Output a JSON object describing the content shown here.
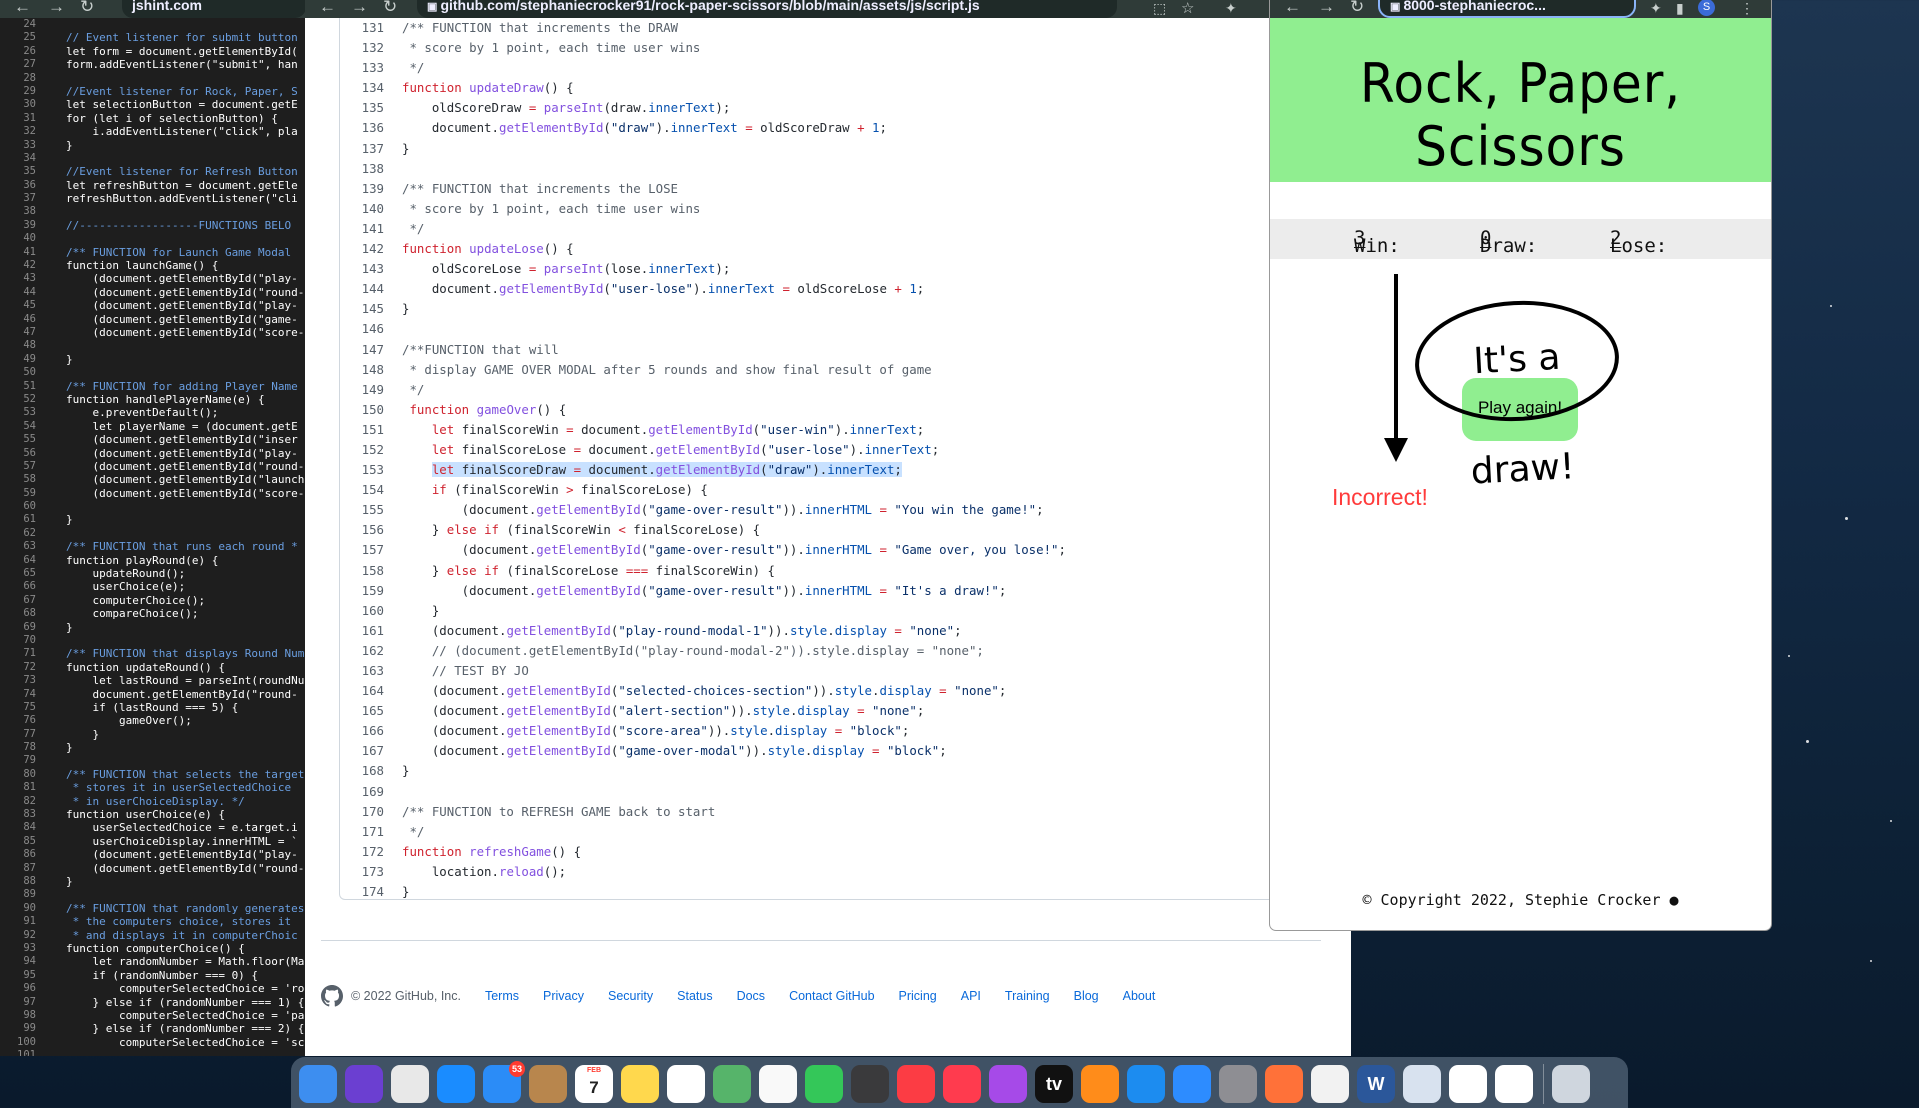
{
  "windows": {
    "jshint": {
      "tab_title": "jshint.com",
      "code_lines": [
        {
          "n": "24",
          "t": ""
        },
        {
          "n": "25",
          "t": "// Event listener for submit button",
          "c": "cm"
        },
        {
          "n": "26",
          "t": "let form = document.getElementById("
        },
        {
          "n": "27",
          "t": "form.addEventListener(\"submit\", han"
        },
        {
          "n": "28",
          "t": ""
        },
        {
          "n": "29",
          "t": "//Event listener for Rock, Paper, S",
          "c": "cm"
        },
        {
          "n": "30",
          "t": "let selectionButton = document.getE"
        },
        {
          "n": "31",
          "t": "for (let i of selectionButton) {"
        },
        {
          "n": "32",
          "t": "    i.addEventListener(\"click\", pla"
        },
        {
          "n": "33",
          "t": "}"
        },
        {
          "n": "34",
          "t": ""
        },
        {
          "n": "35",
          "t": "//Event listener for Refresh Button",
          "c": "cm"
        },
        {
          "n": "36",
          "t": "let refreshButton = document.getEle"
        },
        {
          "n": "37",
          "t": "refreshButton.addEventListener(\"cli"
        },
        {
          "n": "38",
          "t": ""
        },
        {
          "n": "39",
          "t": "//------------------FUNCTIONS BELO",
          "c": "cm"
        },
        {
          "n": "40",
          "t": ""
        },
        {
          "n": "41",
          "t": "/** FUNCTION for Launch Game Modal",
          "c": "cm"
        },
        {
          "n": "42",
          "t": "function launchGame() {"
        },
        {
          "n": "43",
          "t": "    (document.getElementById(\"play-"
        },
        {
          "n": "44",
          "t": "    (document.getElementById(\"round-"
        },
        {
          "n": "45",
          "t": "    (document.getElementById(\"play-"
        },
        {
          "n": "46",
          "t": "    (document.getElementById(\"game-"
        },
        {
          "n": "47",
          "t": "    (document.getElementById(\"score-"
        },
        {
          "n": "48",
          "t": ""
        },
        {
          "n": "49",
          "t": "}"
        },
        {
          "n": "50",
          "t": ""
        },
        {
          "n": "51",
          "t": "/** FUNCTION for adding Player Name",
          "c": "cm"
        },
        {
          "n": "52",
          "t": "function handlePlayerName(e) {"
        },
        {
          "n": "53",
          "t": "    e.preventDefault();"
        },
        {
          "n": "54",
          "t": "    let playerName = (document.getE"
        },
        {
          "n": "55",
          "t": "    (document.getElementById(\"inser"
        },
        {
          "n": "56",
          "t": "    (document.getElementById(\"play-"
        },
        {
          "n": "57",
          "t": "    (document.getElementById(\"round-"
        },
        {
          "n": "58",
          "t": "    (document.getElementById(\"launch"
        },
        {
          "n": "59",
          "t": "    (document.getElementById(\"score-"
        },
        {
          "n": "60",
          "t": ""
        },
        {
          "n": "61",
          "t": "}"
        },
        {
          "n": "62",
          "t": ""
        },
        {
          "n": "63",
          "t": "/** FUNCTION that runs each round *",
          "c": "cm"
        },
        {
          "n": "64",
          "t": "function playRound(e) {"
        },
        {
          "n": "65",
          "t": "    updateRound();"
        },
        {
          "n": "66",
          "t": "    userChoice(e);"
        },
        {
          "n": "67",
          "t": "    computerChoice();"
        },
        {
          "n": "68",
          "t": "    compareChoice();"
        },
        {
          "n": "69",
          "t": "}"
        },
        {
          "n": "70",
          "t": ""
        },
        {
          "n": "71",
          "t": "/** FUNCTION that displays Round Num",
          "c": "cm"
        },
        {
          "n": "72",
          "t": "function updateRound() {"
        },
        {
          "n": "73",
          "t": "    let lastRound = parseInt(roundNu"
        },
        {
          "n": "74",
          "t": "    document.getElementById(\"round-"
        },
        {
          "n": "75",
          "t": "    if (lastRound === 5) {"
        },
        {
          "n": "76",
          "t": "        gameOver();"
        },
        {
          "n": "77",
          "t": "    }"
        },
        {
          "n": "78",
          "t": "}"
        },
        {
          "n": "79",
          "t": ""
        },
        {
          "n": "80",
          "t": "/** FUNCTION that selects the target",
          "c": "cm"
        },
        {
          "n": "81",
          "t": " * stores it in userSelectedChoice",
          "c": "cm"
        },
        {
          "n": "82",
          "t": " * in userChoiceDisplay. */",
          "c": "cm"
        },
        {
          "n": "83",
          "t": "function userChoice(e) {"
        },
        {
          "n": "84",
          "t": "    userSelectedChoice = e.target.i"
        },
        {
          "n": "85",
          "t": "    userChoiceDisplay.innerHTML = `"
        },
        {
          "n": "86",
          "t": "    (document.getElementById(\"play-"
        },
        {
          "n": "87",
          "t": "    (document.getElementById(\"round-"
        },
        {
          "n": "88",
          "t": "}"
        },
        {
          "n": "89",
          "t": ""
        },
        {
          "n": "90",
          "t": "/** FUNCTION that randomly generates",
          "c": "cm"
        },
        {
          "n": "91",
          "t": " * the computers choice, stores it",
          "c": "cm"
        },
        {
          "n": "92",
          "t": " * and displays it in computerChoic",
          "c": "cm"
        },
        {
          "n": "93",
          "t": "function computerChoice() {"
        },
        {
          "n": "94",
          "t": "    let randomNumber = Math.floor(Ma"
        },
        {
          "n": "95",
          "t": "    if (randomNumber === 0) {"
        },
        {
          "n": "96",
          "t": "        computerSelectedChoice = 'ro"
        },
        {
          "n": "97",
          "t": "    } else if (randomNumber === 1) {"
        },
        {
          "n": "98",
          "t": "        computerSelectedChoice = 'pa"
        },
        {
          "n": "99",
          "t": "    } else if (randomNumber === 2) {"
        },
        {
          "n": "100",
          "t": "        computerSelectedChoice = 'sc"
        },
        {
          "n": "101",
          "t": ""
        }
      ]
    },
    "github": {
      "url": "github.com/stephaniecrocker91/rock-paper-scissors/blob/main/assets/js/script.js",
      "code_lines": [
        {
          "n": "131",
          "h": "<span>/** FUNCTION that increments the DRAW</span>",
          "c": "cm"
        },
        {
          "n": "132",
          "h": "<span> * score by 1 point, each time user wins</span>",
          "c": "cm"
        },
        {
          "n": "133",
          "h": "<span> */</span>",
          "c": "cm"
        },
        {
          "n": "134",
          "h": "<span class='k'>function</span> <span class='f'>updateDraw</span>() {"
        },
        {
          "n": "135",
          "h": "    oldScoreDraw <span class='k'>=</span> <span class='f'>parseInt</span>(draw.<span class='p'>innerText</span>);"
        },
        {
          "n": "136",
          "h": "    document.<span class='f'>getElementById</span>(<span class='s'>\"draw\"</span>).<span class='p'>innerText</span> <span class='k'>=</span> oldScoreDraw <span class='k'>+</span> <span class='p'>1</span>;"
        },
        {
          "n": "137",
          "h": "}"
        },
        {
          "n": "138",
          "h": ""
        },
        {
          "n": "139",
          "h": "<span>/** FUNCTION that increments the LOSE</span>",
          "c": "cm"
        },
        {
          "n": "140",
          "h": "<span> * score by 1 point, each time user wins</span>",
          "c": "cm"
        },
        {
          "n": "141",
          "h": "<span> */</span>",
          "c": "cm"
        },
        {
          "n": "142",
          "h": "<span class='k'>function</span> <span class='f'>updateLose</span>() {"
        },
        {
          "n": "143",
          "h": "    oldScoreLose <span class='k'>=</span> <span class='f'>parseInt</span>(lose.<span class='p'>innerText</span>);"
        },
        {
          "n": "144",
          "h": "    document.<span class='f'>getElementById</span>(<span class='s'>\"user-lose\"</span>).<span class='p'>innerText</span> <span class='k'>=</span> oldScoreLose <span class='k'>+</span> <span class='p'>1</span>;"
        },
        {
          "n": "145",
          "h": "}"
        },
        {
          "n": "146",
          "h": ""
        },
        {
          "n": "147",
          "h": "<span>/**FUNCTION that will</span>",
          "c": "cm"
        },
        {
          "n": "148",
          "h": "<span> * display GAME OVER MODAL after 5 rounds and show final result of game</span>",
          "c": "cm"
        },
        {
          "n": "149",
          "h": "<span> */</span>",
          "c": "cm"
        },
        {
          "n": "150",
          "h": " <span class='k'>function</span> <span class='f'>gameOver</span>() {"
        },
        {
          "n": "151",
          "h": "    <span class='k'>let</span> finalScoreWin <span class='k'>=</span> document.<span class='f'>getElementById</span>(<span class='s'>\"user-win\"</span>).<span class='p'>innerText</span>;"
        },
        {
          "n": "152",
          "h": "    <span class='k'>let</span> finalScoreLose <span class='k'>=</span> document.<span class='f'>getElementById</span>(<span class='s'>\"user-lose\"</span>).<span class='p'>innerText</span>;"
        },
        {
          "n": "153",
          "h": "    <span class='hl'><span class='k'>let</span> finalScoreDraw <span class='k'>=</span> document.<span class='f'>getElementById</span>(<span class='s'>\"draw\"</span>).<span class='p'>innerText</span>;</span>"
        },
        {
          "n": "154",
          "h": "    <span class='k'>if</span> (finalScoreWin <span class='k'>&gt;</span> finalScoreLose) {"
        },
        {
          "n": "155",
          "h": "        (document.<span class='f'>getElementById</span>(<span class='s'>\"game-over-result\"</span>)).<span class='p'>innerHTML</span> <span class='k'>=</span> <span class='s'>\"You win the game!\"</span>;"
        },
        {
          "n": "156",
          "h": "    } <span class='k'>else if</span> (finalScoreWin <span class='k'>&lt;</span> finalScoreLose) {"
        },
        {
          "n": "157",
          "h": "        (document.<span class='f'>getElementById</span>(<span class='s'>\"game-over-result\"</span>)).<span class='p'>innerHTML</span> <span class='k'>=</span> <span class='s'>\"Game over, you lose!\"</span>;"
        },
        {
          "n": "158",
          "h": "    } <span class='k'>else if</span> (finalScoreLose <span class='k'>===</span> finalScoreWin) {"
        },
        {
          "n": "159",
          "h": "        (document.<span class='f'>getElementById</span>(<span class='s'>\"game-over-result\"</span>)).<span class='p'>innerHTML</span> <span class='k'>=</span> <span class='s'>\"It's a draw!\"</span>;"
        },
        {
          "n": "160",
          "h": "    }"
        },
        {
          "n": "161",
          "h": "    (document.<span class='f'>getElementById</span>(<span class='s'>\"play-round-modal-1\"</span>)).<span class='p'>style</span>.<span class='p'>display</span> <span class='k'>=</span> <span class='s'>\"none\"</span>;"
        },
        {
          "n": "162",
          "h": "    <span style='color:#57606a'>// (document.getElementById(\"play-round-modal-2\")).style.display = \"none\";</span>"
        },
        {
          "n": "163",
          "h": "    <span style='color:#57606a'>// TEST BY JO</span>"
        },
        {
          "n": "164",
          "h": "    (document.<span class='f'>getElementById</span>(<span class='s'>\"selected-choices-section\"</span>)).<span class='p'>style</span>.<span class='p'>display</span> <span class='k'>=</span> <span class='s'>\"none\"</span>;"
        },
        {
          "n": "165",
          "h": "    (document.<span class='f'>getElementById</span>(<span class='s'>\"alert-section\"</span>)).<span class='p'>style</span>.<span class='p'>display</span> <span class='k'>=</span> <span class='s'>\"none\"</span>;"
        },
        {
          "n": "166",
          "h": "    (document.<span class='f'>getElementById</span>(<span class='s'>\"score-area\"</span>)).<span class='p'>style</span>.<span class='p'>display</span> <span class='k'>=</span> <span class='s'>\"block\"</span>;"
        },
        {
          "n": "167",
          "h": "    (document.<span class='f'>getElementById</span>(<span class='s'>\"game-over-modal\"</span>)).<span class='p'>style</span>.<span class='p'>display</span> <span class='k'>=</span> <span class='s'>\"block\"</span>;"
        },
        {
          "n": "168",
          "h": "}"
        },
        {
          "n": "169",
          "h": ""
        },
        {
          "n": "170",
          "h": "<span>/** FUNCTION to REFRESH GAME back to start</span>",
          "c": "cm"
        },
        {
          "n": "171",
          "h": "<span> */</span>",
          "c": "cm"
        },
        {
          "n": "172",
          "h": "<span class='k'>function</span> <span class='f'>refreshGame</span>() {"
        },
        {
          "n": "173",
          "h": "    location.<span class='f'>reload</span>();"
        },
        {
          "n": "174",
          "h": "}"
        }
      ],
      "footer": {
        "copyright": "© 2022 GitHub, Inc.",
        "links": [
          "Terms",
          "Privacy",
          "Security",
          "Status",
          "Docs",
          "Contact GitHub",
          "Pricing",
          "API",
          "Training",
          "Blog",
          "About"
        ]
      }
    },
    "preview": {
      "url": "8000-stephaniecroc...",
      "title": "Rock, Paper, Scissors",
      "score": {
        "win_label": "Win:",
        "win": "3",
        "draw_label": "Draw:",
        "draw": "0",
        "lose_label": "Lose:",
        "lose": "2"
      },
      "result_message": "It's a draw!",
      "play_again": "Play again!",
      "alert": "Incorrect!",
      "copyright": "© Copyright 2022, Stephie Crocker"
    }
  },
  "dock": {
    "apps": [
      {
        "icon": "finder-icon",
        "color": "#3d8ef0"
      },
      {
        "icon": "siri-icon",
        "color": "#6b3fd1"
      },
      {
        "icon": "launchpad-icon",
        "color": "#e8e8e8"
      },
      {
        "icon": "safari-icon",
        "color": "#1a8cff"
      },
      {
        "icon": "mail-icon",
        "color": "#2b8cf7",
        "badge": "53"
      },
      {
        "icon": "contacts-icon",
        "color": "#b8864d"
      },
      {
        "icon": "calendar-icon",
        "color": "#ffffff",
        "label": "7",
        "sub": "FEB"
      },
      {
        "icon": "notes-icon",
        "color": "#ffd84d"
      },
      {
        "icon": "reminders-icon",
        "color": "#ffffff"
      },
      {
        "icon": "maps-icon",
        "color": "#56b46a"
      },
      {
        "icon": "photos-icon",
        "color": "#f9f9f9"
      },
      {
        "icon": "messages-icon",
        "color": "#34c759"
      },
      {
        "icon": "screenshot-icon",
        "color": "#3a3a3c"
      },
      {
        "icon": "music-icon",
        "color": "#fc3c44"
      },
      {
        "icon": "news-icon",
        "color": "#ff3b4e"
      },
      {
        "icon": "podcasts-icon",
        "color": "#a64ae8"
      },
      {
        "icon": "tv-icon",
        "color": "#111111",
        "label": "tv"
      },
      {
        "icon": "books-icon",
        "color": "#ff8c1a"
      },
      {
        "icon": "appstore-icon",
        "color": "#1c8cf0"
      },
      {
        "icon": "zoom-icon",
        "color": "#2d8cff"
      },
      {
        "icon": "system-preferences-icon",
        "color": "#8e8e93"
      },
      {
        "icon": "firefox-icon",
        "color": "#ff7139"
      },
      {
        "icon": "chrome-icon",
        "color": "#f2f2f2"
      },
      {
        "icon": "word-icon",
        "color": "#2b579a",
        "label": "W"
      },
      {
        "icon": "preview-icon",
        "color": "#d8e2ef"
      },
      {
        "icon": "slack-icon",
        "color": "#ffffff"
      },
      {
        "icon": "emoji-icon",
        "color": "#ffffff"
      },
      {
        "icon": "trash-icon",
        "color": "#cfd6de"
      }
    ]
  }
}
